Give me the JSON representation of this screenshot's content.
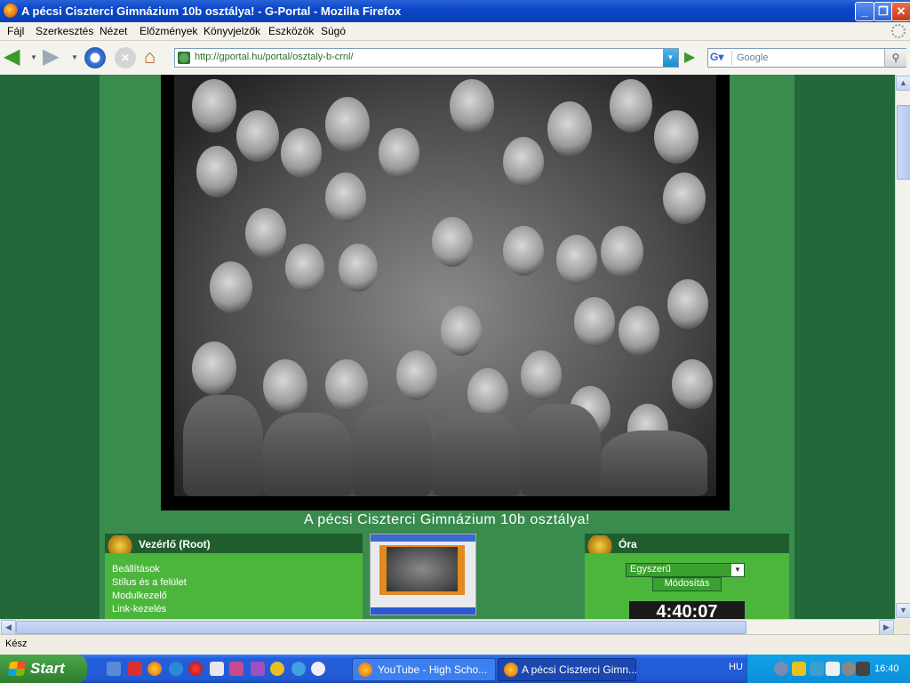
{
  "window": {
    "title": "A pécsi Ciszterci Gimnázium 10b osztálya! - G-Portal - Mozilla Firefox"
  },
  "menu": [
    "Fájl",
    "Szerkesztés",
    "Nézet",
    "Előzmények",
    "Könyvjelzők",
    "Eszközök",
    "Súgó"
  ],
  "navbar": {
    "url": "http://gportal.hu/portal/osztaly-b-crnl/",
    "search_placeholder": "Google"
  },
  "page": {
    "caption": "A pécsi Ciszterci Gimnázium 10b osztálya!",
    "left_panel": {
      "title": "Vezérlő (Root)",
      "links": [
        "Beállítások",
        "Stílus és a felület",
        "Modulkezelő",
        "Link-kezelés"
      ]
    },
    "right_panel": {
      "title": "Óra",
      "select_value": "Egyszerű",
      "modify_button": "Módosítás",
      "clock": "4:40:07"
    }
  },
  "statusbar": {
    "text": "Kész"
  },
  "taskbar": {
    "start": "Start",
    "tasks": [
      "YouTube - High Scho...",
      "A pécsi Ciszterci Gimn..."
    ],
    "lang": "HU",
    "time": "16:40"
  },
  "colors": {
    "page_bg": "#22693a",
    "panel_header": "#1f5e2c",
    "panel_body": "#4cb63c",
    "taskbar": "#245edb"
  }
}
